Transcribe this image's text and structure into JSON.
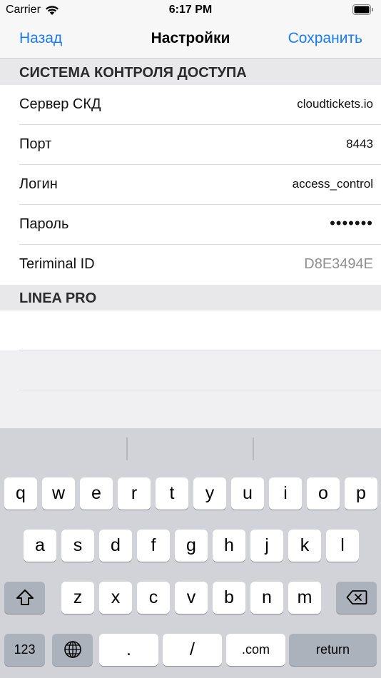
{
  "status_bar": {
    "carrier": "Carrier",
    "time": "6:17 PM"
  },
  "nav": {
    "back_label": "Назад",
    "title": "Настройки",
    "save_label": "Сохранить"
  },
  "sections": [
    {
      "header": "СИСТЕМА КОНТРОЛЯ ДОСТУПА",
      "rows": [
        {
          "label": "Сервер СКД",
          "value": "cloudtickets.io"
        },
        {
          "label": "Порт",
          "value": "8443"
        },
        {
          "label": "Логин",
          "value": "access_control"
        },
        {
          "label": "Пароль",
          "value": "•••••••"
        },
        {
          "label": "Teriminal ID",
          "value": "D8E3494E"
        }
      ]
    },
    {
      "header": "LINEA PRO",
      "rows": []
    }
  ],
  "keyboard": {
    "row1": [
      "q",
      "w",
      "e",
      "r",
      "t",
      "y",
      "u",
      "i",
      "o",
      "p"
    ],
    "row2": [
      "a",
      "s",
      "d",
      "f",
      "g",
      "h",
      "j",
      "k",
      "l"
    ],
    "row3": [
      "z",
      "x",
      "c",
      "v",
      "b",
      "n",
      "m"
    ],
    "shift_icon": "shift-icon",
    "backspace_icon": "backspace-icon",
    "numbers_label": "123",
    "globe_icon": "globe-icon",
    "dot_label": ".",
    "slash_label": "/",
    "com_label": ".com",
    "return_label": "return"
  },
  "colors": {
    "accent": "#1a7cf5",
    "section_bg": "#e8e8ea",
    "keyboard_bg": "#d1d3d9"
  }
}
